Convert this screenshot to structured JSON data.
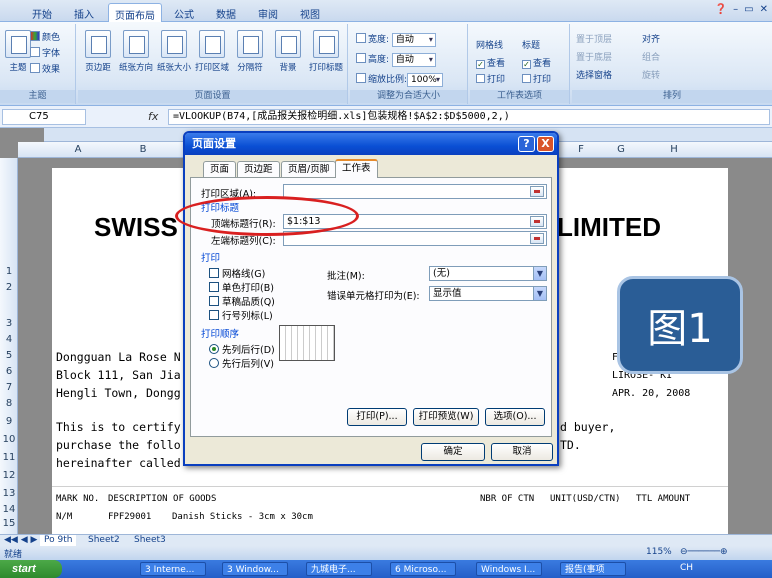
{
  "ribbon": {
    "tabs": [
      "开始",
      "插入",
      "页面布局",
      "公式",
      "数据",
      "审阅",
      "视图"
    ],
    "active_tab": "页面布局",
    "theme_group": {
      "label": "主题",
      "items": [
        "主题",
        "颜色",
        "字体",
        "效果"
      ]
    },
    "page_setup_group": {
      "label": "页面设置",
      "buttons": [
        "页边距",
        "纸张方向",
        "纸张大小",
        "打印区域",
        "分隔符",
        "背景",
        "打印标题"
      ]
    },
    "scale_group": {
      "label": "调整为合适大小",
      "width_label": "宽度:",
      "width_value": "自动",
      "height_label": "高度:",
      "height_value": "自动",
      "scale_label": "缩放比例:",
      "scale_value": "100%"
    },
    "sheet_options_group": {
      "label": "工作表选项",
      "gridlines": "网格线",
      "headings": "标题",
      "view": "查看",
      "print": "打印"
    },
    "arrange_group": {
      "label": "排列",
      "items": [
        "置于顶层",
        "置于底层",
        "选择窗格",
        "对齐",
        "组合",
        "旋转"
      ]
    }
  },
  "formula_bar": {
    "name_box": "C75",
    "fx": "fx",
    "formula": "=VLOOKUP(B74,[成品报关报检明细.xls]包装规格!$A$2:$D$5000,2,)"
  },
  "sheet": {
    "columns": [
      "A",
      "B",
      "F",
      "G",
      "H"
    ],
    "rows": [
      "1",
      "2",
      "3",
      "4",
      "5",
      "6",
      "7",
      "8",
      "9",
      "10",
      "11",
      "12",
      "13",
      "14",
      "15"
    ],
    "title_left": "SWISS",
    "title_right": "LIMITED",
    "lines": [
      "Dongguan La Rose N",
      "Block 111, San Jia",
      "Hengli Town, Dongg",
      "This is to certify",
      "purchase the follo",
      "hereinafter called"
    ],
    "right_cells": [
      "F",
      "LIROSE- KI",
      "APR. 20, 2008",
      "d buyer,",
      "TD."
    ],
    "header_row": {
      "mark": "MARK NO.",
      "desc": "DESCRIPTION OF GOODS",
      "ctn": "NBR OF CTN",
      "unit": "UNIT(USD/CTN)",
      "amount": "TTL AMOUNT"
    },
    "data_row": {
      "mark": "N/M",
      "code": "FPF29001",
      "desc": "Danish Sticks - 3cm x 30cm"
    }
  },
  "badge": "图1",
  "dialog": {
    "title": "页面设置",
    "help": "?",
    "close": "X",
    "tabs": [
      "页面",
      "页边距",
      "页眉/页脚",
      "工作表"
    ],
    "active_tab": "工作表",
    "print_area_label": "打印区域(A):",
    "print_titles_section": "打印标题",
    "rows_repeat_label": "顶端标题行(R):",
    "rows_repeat_value": "$1:$13",
    "cols_repeat_label": "左端标题列(C):",
    "print_section": "打印",
    "checkboxes": [
      "网格线(G)",
      "单色打印(B)",
      "草稿品质(Q)",
      "行号列标(L)"
    ],
    "comments_label": "批注(M):",
    "comments_value": "(无)",
    "errors_label": "错误单元格打印为(E):",
    "errors_value": "显示值",
    "order_section": "打印顺序",
    "order_options": [
      "先列后行(D)",
      "先行后列(V)"
    ],
    "buttons": {
      "print": "打印(P)...",
      "preview": "打印预览(W)",
      "options": "选项(O)...",
      "ok": "确定",
      "cancel": "取消"
    }
  },
  "sheet_tabs": [
    "Po 9th",
    "Sheet2",
    "Sheet3"
  ],
  "status": {
    "left": "就绪",
    "zoom": "115%"
  },
  "taskbar": {
    "start": "start",
    "tasks": [
      "3 Interne...",
      "3 Window...",
      "九城电子...",
      "6 Microso...",
      "Windows I...",
      "报告(事项"
    ],
    "tray": "CH"
  }
}
